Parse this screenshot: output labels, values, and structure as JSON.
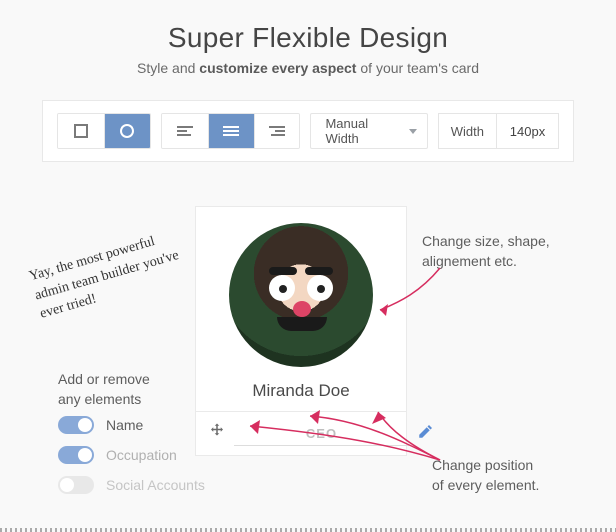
{
  "header": {
    "title": "Super Flexible Design",
    "subtitle_pre": "Style and ",
    "subtitle_bold": "customize every aspect",
    "subtitle_post": " of your team's card"
  },
  "toolbar": {
    "dropdown_label": "Manual Width",
    "width_label": "Width",
    "width_value": "140px"
  },
  "card": {
    "name": "Miranda Doe",
    "occupation": "CEO"
  },
  "annotations": {
    "hand": "Yay, the most powerful admin team builder you've ever tried!",
    "change_size": "Change size, shape, alignement etc.",
    "add_remove_l1": "Add or remove",
    "add_remove_l2": "any elements",
    "change_pos_l1": "Change position",
    "change_pos_l2": "of every element."
  },
  "toggles": {
    "name_label": "Name",
    "occupation_label": "Occupation",
    "social_label": "Social Accounts"
  }
}
